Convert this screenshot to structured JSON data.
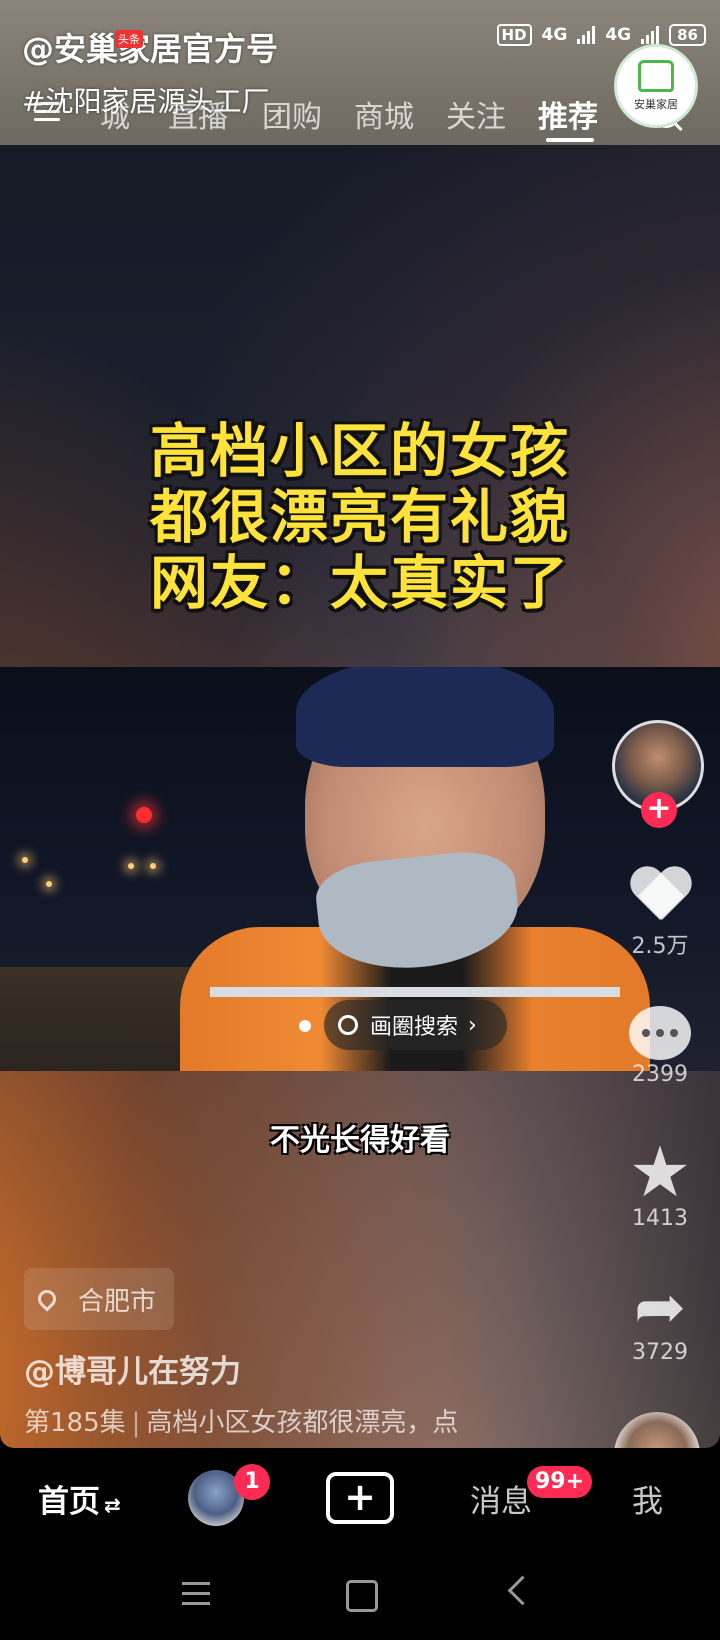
{
  "status": {
    "hd": "HD",
    "net1": "4G",
    "net2": "4G",
    "battery": "86"
  },
  "nav": {
    "tabs": [
      {
        "label": "城"
      },
      {
        "label": "直播"
      },
      {
        "label": "团购"
      },
      {
        "label": "商城"
      },
      {
        "label": "关注"
      },
      {
        "label": "推荐"
      }
    ],
    "active_tab": "推荐"
  },
  "watermark": {
    "account": "@安巢家居官方号",
    "tag": "#沈阳家居源头工厂",
    "badge": "头条",
    "logo_text": "安巢家居"
  },
  "video": {
    "title_lines": [
      "高档小区的女孩",
      "都很漂亮有礼貌",
      "网友：太真实了"
    ],
    "subtitle": "不光长得好看",
    "circle_search": "画圈搜索"
  },
  "rail": {
    "likes": "2.5万",
    "comments": "2399",
    "favorites": "1413",
    "shares": "3729",
    "follow_symbol": "+"
  },
  "info": {
    "location": "合肥市",
    "author": "@博哥儿在努力",
    "episode": "第185集",
    "description": "高档小区女孩都很漂亮，点"
  },
  "tabbar": {
    "home": "首页",
    "friends_badge": "1",
    "create": "+",
    "messages": "消息",
    "messages_badge": "99+",
    "me": "我"
  }
}
